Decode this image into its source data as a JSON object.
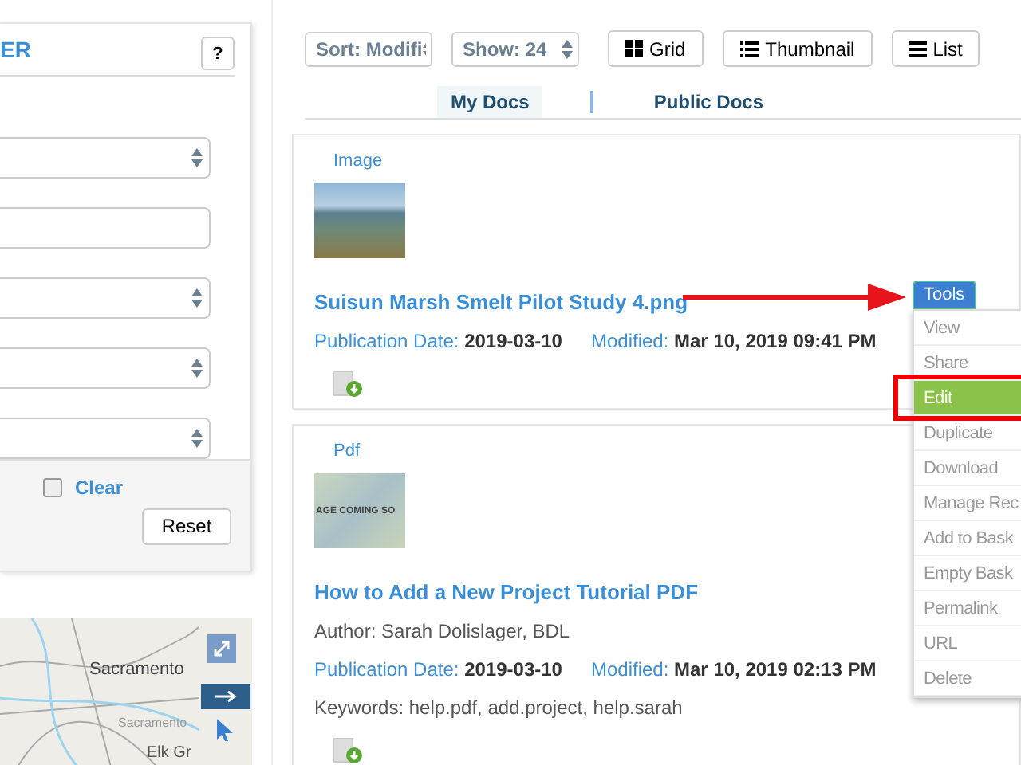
{
  "filter_panel": {
    "title": "ER",
    "help_button": "?",
    "fields": [
      {
        "kind": "select"
      },
      {
        "kind": "text"
      },
      {
        "kind": "select"
      },
      {
        "kind": "select"
      },
      {
        "kind": "select"
      }
    ],
    "clear": {
      "label": "Clear",
      "checked": false
    },
    "reset_button": "Reset"
  },
  "map": {
    "labels": [
      "Sacramento",
      "Sacramento",
      "Elk Gr"
    ]
  },
  "toolbar": {
    "sort": "Sort: Modifi",
    "show": "Show: 24",
    "views": [
      {
        "label": "Grid",
        "kind": "grid"
      },
      {
        "label": "Thumbnail",
        "kind": "thumbnail"
      },
      {
        "label": "List",
        "kind": "list"
      }
    ]
  },
  "tabs": [
    {
      "label": "My Docs",
      "selected": true
    },
    {
      "label": "Public Docs",
      "selected": false
    }
  ],
  "documents": [
    {
      "type": "Image",
      "kind": "photo",
      "title": "Suisun Marsh Smelt Pilot Study 4.png",
      "publication_label": "Publication Date:",
      "publication_date": "2019-03-10",
      "modified_label": "Modified:",
      "modified": "Mar 10, 2019 09:41 PM"
    },
    {
      "type": "Pdf",
      "kind": "placeholder",
      "thumbnail_text": "AGE COMING SO",
      "title": "How to Add a New Project Tutorial PDF",
      "author": "Author: Sarah Dolislager, BDL",
      "publication_label": "Publication Date:",
      "publication_date": "2019-03-10",
      "modified_label": "Modified:",
      "modified": "Mar 10, 2019 02:13 PM",
      "keywords": "Keywords: help.pdf, add.project, help.sarah"
    }
  ],
  "tools_menu": {
    "button": "Tools",
    "items": [
      {
        "label": "View",
        "selected": false
      },
      {
        "label": "Share",
        "selected": false
      },
      {
        "label": "Edit",
        "selected": true
      },
      {
        "label": "Duplicate",
        "selected": false
      },
      {
        "label": "Download",
        "selected": false
      },
      {
        "label": "Manage Rec",
        "selected": false
      },
      {
        "label": "Add to Bask",
        "selected": false
      },
      {
        "label": "Empty Bask",
        "selected": false
      },
      {
        "label": "Permalink",
        "selected": false
      },
      {
        "label": "URL",
        "selected": false
      },
      {
        "label": "Delete",
        "selected": false
      }
    ]
  }
}
